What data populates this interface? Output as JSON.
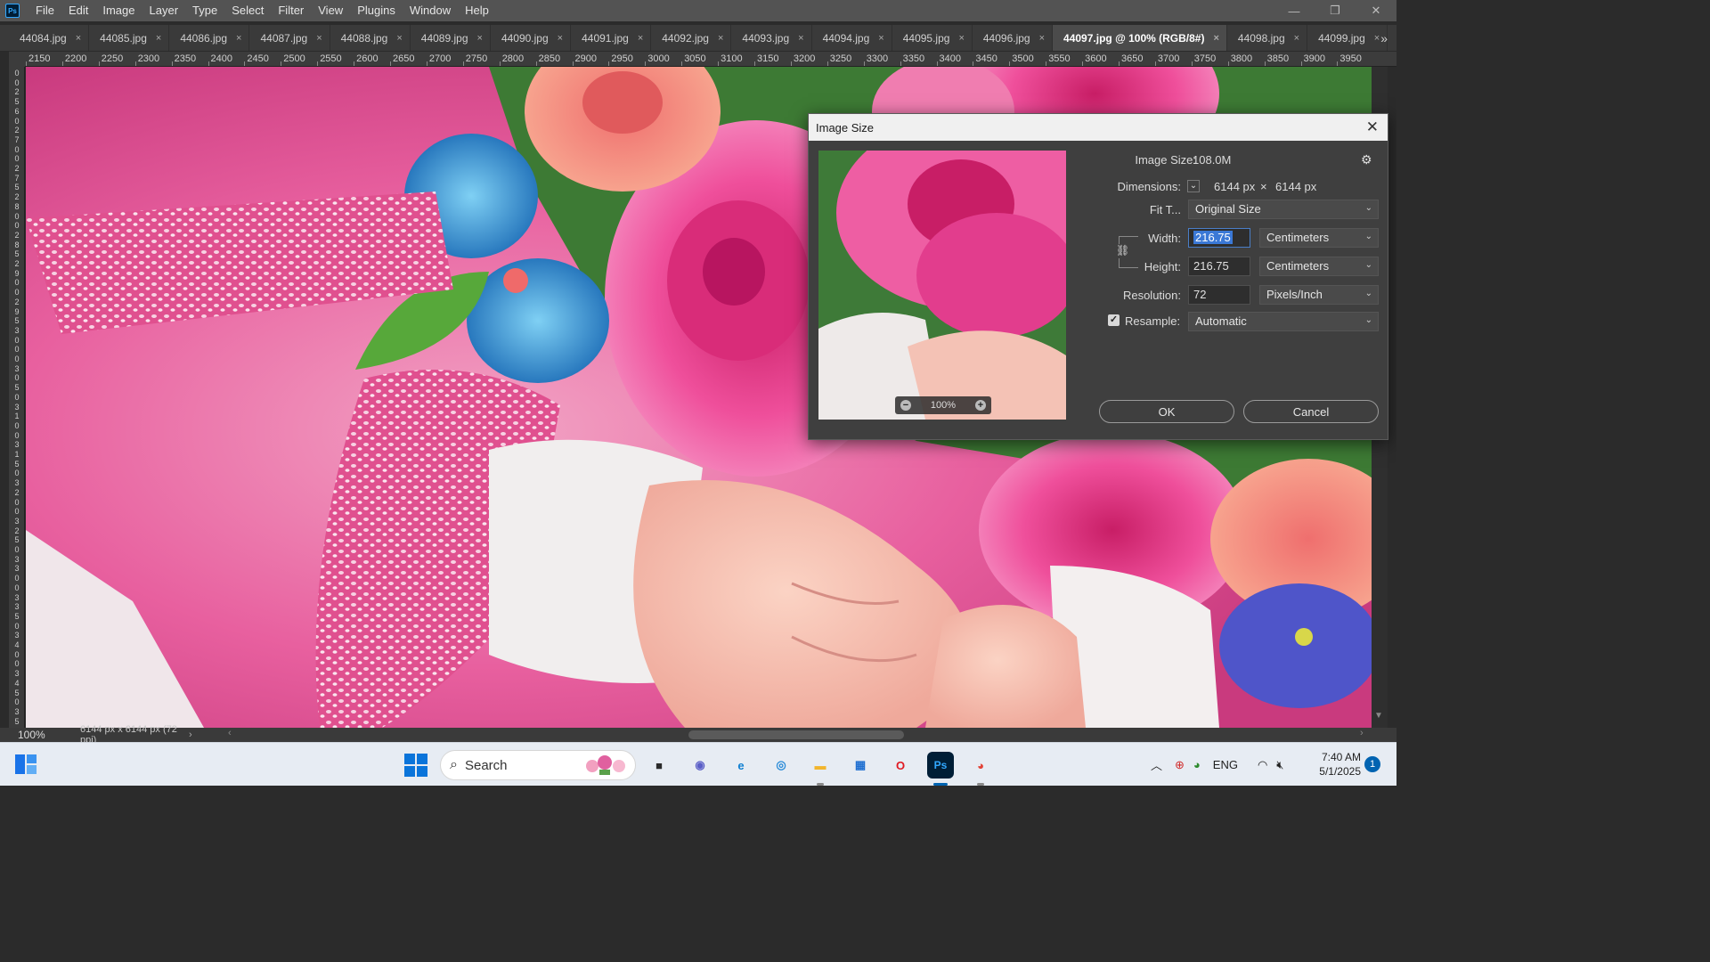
{
  "app": {
    "logo_text": "Ps"
  },
  "menu": [
    "File",
    "Edit",
    "Image",
    "Layer",
    "Type",
    "Select",
    "Filter",
    "View",
    "Plugins",
    "Window",
    "Help"
  ],
  "window_controls": {
    "minimize": "—",
    "maximize": "❐",
    "close": "✕"
  },
  "tabs": [
    {
      "label": "44084.jpg",
      "active": false
    },
    {
      "label": "44085.jpg",
      "active": false
    },
    {
      "label": "44086.jpg",
      "active": false
    },
    {
      "label": "44087.jpg",
      "active": false
    },
    {
      "label": "44088.jpg",
      "active": false
    },
    {
      "label": "44089.jpg",
      "active": false
    },
    {
      "label": "44090.jpg",
      "active": false
    },
    {
      "label": "44091.jpg",
      "active": false
    },
    {
      "label": "44092.jpg",
      "active": false
    },
    {
      "label": "44093.jpg",
      "active": false
    },
    {
      "label": "44094.jpg",
      "active": false
    },
    {
      "label": "44095.jpg",
      "active": false
    },
    {
      "label": "44096.jpg",
      "active": false
    },
    {
      "label": "44097.jpg @ 100% (RGB/8#)",
      "active": true
    },
    {
      "label": "44098.jpg",
      "active": false
    },
    {
      "label": "44099.jpg",
      "active": false
    }
  ],
  "tab_close_glyph": "×",
  "tab_overflow_glyph": "»",
  "ruler": {
    "top_labels": [
      "2150",
      "2200",
      "2250",
      "2300",
      "2350",
      "2400",
      "2450",
      "2500",
      "2550",
      "2600",
      "2650",
      "2700",
      "2750",
      "2800",
      "2850",
      "2900",
      "2950",
      "3000",
      "3050",
      "3100",
      "3150",
      "3200",
      "3250",
      "3300",
      "3350",
      "3400",
      "3450",
      "3500",
      "3550",
      "3600",
      "3650",
      "3700",
      "3750",
      "3800",
      "3850",
      "3900",
      "3950"
    ],
    "left_digits": [
      "0",
      "0",
      "2",
      "5",
      "6",
      "0",
      "2",
      "7",
      "0",
      "0",
      "2",
      "7",
      "5",
      "2",
      "8",
      "0",
      "0",
      "2",
      "8",
      "5",
      "2",
      "9",
      "0",
      "0",
      "2",
      "9",
      "5",
      "3",
      "0",
      "0",
      "0",
      "3",
      "0",
      "5",
      "0",
      "3",
      "1",
      "0",
      "0",
      "3",
      "1",
      "5",
      "0",
      "3",
      "2",
      "0",
      "0",
      "3",
      "2",
      "5",
      "0",
      "3",
      "3",
      "0",
      "0",
      "3",
      "3",
      "5",
      "0",
      "3",
      "4",
      "0",
      "0",
      "3",
      "4",
      "5",
      "0",
      "3",
      "5"
    ]
  },
  "status": {
    "zoom": "100%",
    "doc_info": "6144 px x 6144 px (72 ppi)",
    "arrow": "›"
  },
  "dialog": {
    "title": "Image Size",
    "close_glyph": "✕",
    "preview_zoom": "100%",
    "image_size_label": "Image Size:",
    "image_size_value": "108.0M",
    "dimensions_label": "Dimensions:",
    "dim_width": "6144 px",
    "dim_times": "×",
    "dim_height": "6144 px",
    "fit_label": "Fit T...",
    "fit_value": "Original Size",
    "width_label": "Width:",
    "width_value": "216.75",
    "width_unit": "Centimeters",
    "height_label": "Height:",
    "height_value": "216.75",
    "height_unit": "Centimeters",
    "resolution_label": "Resolution:",
    "resolution_value": "72",
    "resolution_unit": "Pixels/Inch",
    "resample_label": "Resample:",
    "resample_checked": true,
    "resample_value": "Automatic",
    "ok_label": "OK",
    "cancel_label": "Cancel"
  },
  "taskbar": {
    "search_label": "Search",
    "language": "ENG",
    "time": "7:40 AM",
    "date": "5/1/2025",
    "notification_count": "1",
    "apps": [
      {
        "name": "file-explorer-dark",
        "glyph": "■",
        "color": "#2b2b2b"
      },
      {
        "name": "teams",
        "glyph": "◉",
        "color": "#5b5fc7"
      },
      {
        "name": "edge",
        "glyph": "e",
        "color": "#0f7fd1"
      },
      {
        "name": "lens",
        "glyph": "◎",
        "color": "#2a8bd8"
      },
      {
        "name": "folder",
        "glyph": "▬",
        "color": "#f2b52c"
      },
      {
        "name": "store",
        "glyph": "▦",
        "color": "#1f6fd1"
      },
      {
        "name": "opera",
        "glyph": "O",
        "color": "#e01a22"
      },
      {
        "name": "photoshop",
        "glyph": "Ps",
        "color": "#31a8ff"
      },
      {
        "name": "chrome",
        "glyph": "◕",
        "color": "#e24236"
      }
    ]
  },
  "colors": {
    "accent": "#31a8ff",
    "canvas_pink": "#e8509a",
    "rose_magenta": "#e2348a",
    "blue_flower": "#2f8fd8",
    "leaf_green": "#3a8a2e"
  }
}
